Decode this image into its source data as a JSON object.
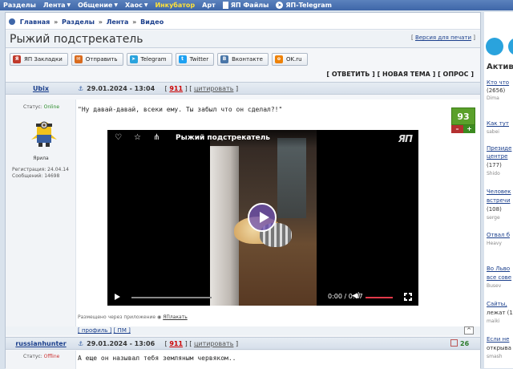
{
  "topnav": {
    "items": [
      "Разделы",
      "Лента",
      "Общение",
      "Хаос",
      "Инкубатор",
      "Арт",
      "ЯП Файлы",
      "ЯП-Telegram"
    ]
  },
  "breadcrumb": [
    "Главная",
    "Разделы",
    "Лента",
    "Видео"
  ],
  "page": {
    "title": "Рыжий подстрекатель",
    "print_label": "Версия для печати"
  },
  "share": [
    "ЯП Закладки",
    "Отправить",
    "Telegram",
    "Twitter",
    "Вконтакте",
    "OK.ru"
  ],
  "actions": "[ ОТВЕТИТЬ ] [ НОВАЯ ТЕМА ] [ ОПРОС ]",
  "post1": {
    "author": "Ubix",
    "date": "29.01.2024 - 13:04",
    "num": "911",
    "quote": "цитировать",
    "status_label": "Статус:",
    "status": "Online",
    "avatar_caption": "Ярила",
    "reg_label": "Регистрация: 24.04.14",
    "msgs_label": "Сообщений: 14698",
    "text": "\"Ну давай-давай, всеки ему. Ты забыл что он сделал?!\"",
    "rating": "93",
    "minus": "–",
    "plus": "+",
    "video": {
      "title": "Рыжий подстрекатель",
      "logo": "ЯП",
      "time": "0:00  /  0:07"
    },
    "posted_via_prefix": "Размещено через приложение",
    "posted_via_app": "ЯПлакать",
    "profile": "[ профиль ]",
    "pm": "[ ПМ ]"
  },
  "post2": {
    "author": "russianhunter",
    "date": "29.01.2024 - 13:06",
    "num": "911",
    "quote": "цитировать",
    "status_label": "Статус:",
    "status": "Offline",
    "text": "А еще он называл тебя земляным червяком..",
    "rating": "26"
  },
  "rightbar": {
    "heading": "Активн",
    "items": [
      {
        "link": "Кто что",
        "text": "(2656)",
        "user": "Dima"
      },
      {
        "link": "Как тут",
        "text": "",
        "user": "sabei"
      },
      {
        "link": "Президе",
        "text": "центре",
        "count": "(177)",
        "user": "Shido"
      },
      {
        "link": "Человек",
        "text": "встречи",
        "count": "(108)",
        "user": "serge"
      },
      {
        "link": "Отвал б",
        "text": "",
        "user": "Heavy"
      },
      {
        "link": "Во Льво",
        "text": "все сове",
        "user": "Busev"
      },
      {
        "link": "Сайты,",
        "text": "лежат (1",
        "user": "maiki"
      },
      {
        "link": "Если не",
        "text": "открыва",
        "user": "smash"
      }
    ]
  },
  "colors": {
    "nav": "#3e66a8",
    "accent_yellow": "#ffe23a",
    "rating_green": "#5aa02a",
    "link": "#1b3f8c"
  }
}
